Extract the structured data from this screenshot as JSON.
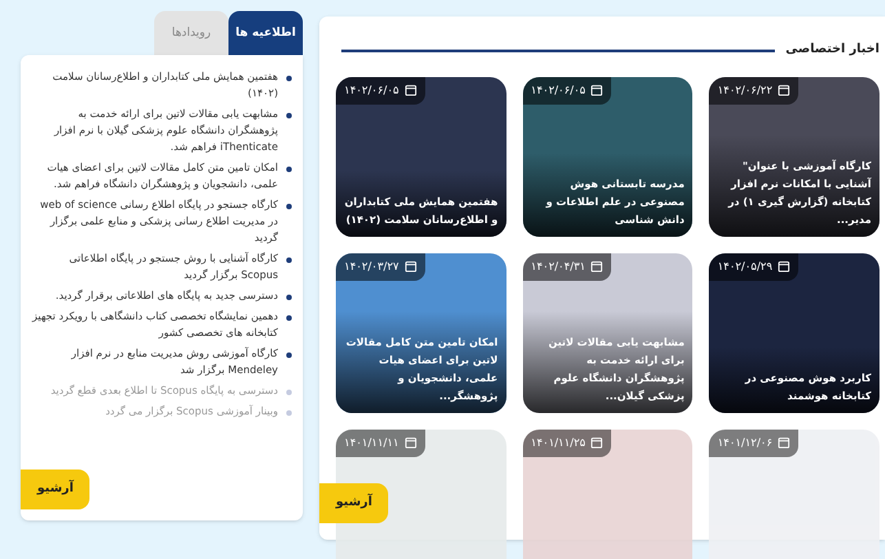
{
  "tabs": [
    {
      "label": "اطلاعیه ها",
      "selected": true
    },
    {
      "label": "رویدادها",
      "selected": false
    }
  ],
  "announcements": [
    {
      "text": "هفتمین همایش ملی کتابداران و اطلاع‌رسانان سلامت (۱۴۰۲)",
      "faded": false
    },
    {
      "text": "مشابهت یابی مقالات لاتین برای ارائه خدمت به پژوهشگران دانشگاه علوم پزشکی گیلان با نرم افزار iThenticate فراهم شد.",
      "faded": false
    },
    {
      "text": "امکان تامین متن کامل مقالات لاتین برای اعضای هیات علمی، دانشجویان و پژوهشگران دانشگاه فراهم شد.",
      "faded": false
    },
    {
      "text": "کارگاه جستجو در پایگاه اطلاع رسانی web of science در مدیریت اطلاع رسانی پزشکی و منابع علمی برگزار گردید",
      "faded": false
    },
    {
      "text": "کارگاه آشنایی با روش جستجو در پایگاه اطلاعاتی Scopus برگزار گردید",
      "faded": false
    },
    {
      "text": "دسترسی جدید به پایگاه های اطلاعاتی برقرار گردید.",
      "faded": false
    },
    {
      "text": "دهمین نمایشگاه تخصصی کتاب دانشگاهی با رویکرد تجهیز کتابخانه های تخصصی کشور",
      "faded": false
    },
    {
      "text": "کارگاه آموزشی روش مدیریت منابع در نرم افزار Mendeley برگزار شد",
      "faded": false
    },
    {
      "text": "دسترسی به پایگاه Scopus تا اطلاع بعدی قطع گردید",
      "faded": true
    },
    {
      "text": "وبینار آموزشی Scopus برگزار می گردد",
      "faded": true
    }
  ],
  "announcements_archive": "آرشیو",
  "news": {
    "heading": "اخبار اختصاصی",
    "cards": [
      {
        "date": "۱۴۰۲/۰۶/۲۲",
        "title": "کارگاه آموزشی با عنوان\" آشنایی با امکانات نرم افزار کتابخانه (گزارش گیری ۱) در مدیر...",
        "faded": false
      },
      {
        "date": "۱۴۰۲/۰۶/۰۵",
        "title": "مدرسه تابستانی هوش مصنوعی در علم اطلاعات و دانش شناسی",
        "faded": false
      },
      {
        "date": "۱۴۰۲/۰۶/۰۵",
        "title": "هفتمین همایش ملی کتابداران و اطلاع‌رسانان سلامت (۱۴۰۲)",
        "faded": false
      },
      {
        "date": "۱۴۰۲/۰۵/۲۹",
        "title": "کاربرد هوش مصنوعی در کتابخانه هوشمند",
        "faded": false
      },
      {
        "date": "۱۴۰۲/۰۴/۳۱",
        "title": "مشابهت یابی مقالات لاتین برای ارائه خدمت به پژوهشگران دانشگاه علوم پزشکی گیلان...",
        "faded": false
      },
      {
        "date": "۱۴۰۲/۰۳/۲۷",
        "title": "امکان تامین متن کامل مقالات لاتین برای اعضای هیات علمی، دانشجویان و پژوهشگر...",
        "faded": false
      },
      {
        "date": "۱۴۰۱/۱۲/۰۶",
        "faded": true
      },
      {
        "date": "۱۴۰۱/۱۱/۲۵",
        "faded": true
      },
      {
        "date": "۱۴۰۱/۱۱/۱۱",
        "faded": true
      }
    ],
    "archive": "آرشیو"
  }
}
